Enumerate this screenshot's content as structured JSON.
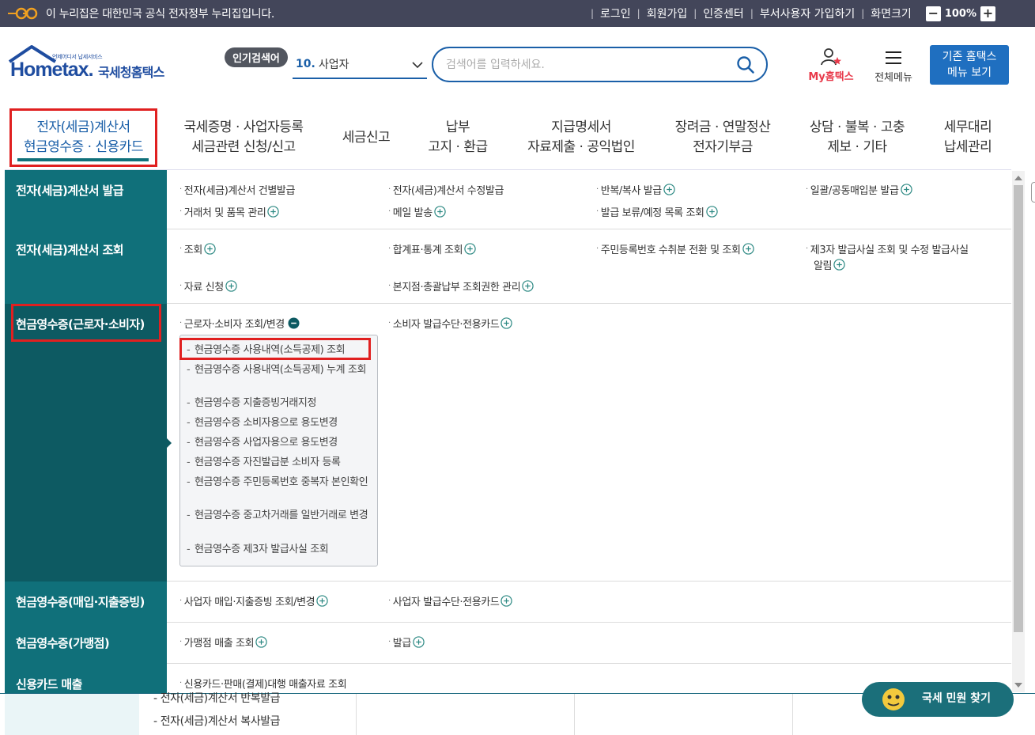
{
  "govbar": {
    "notice": "이 누리집은 대한민국 공식 전자정부 누리집입니다.",
    "links": [
      "로그인",
      "회원가입",
      "인증센터",
      "부서사용자 가입하기",
      "화면크기"
    ],
    "zoom": "100%"
  },
  "header": {
    "logo_text": "Hometax.",
    "logo_kr": "국세청홈택스",
    "logo_mini": "언제어디서 납세서비스",
    "popular_label": "인기검색어",
    "popular_num": "10.",
    "popular_value": "사업자",
    "search_placeholder": "검색어를 입력하세요.",
    "myhome": "My홈택스",
    "allmenu": "전체메뉴",
    "oldmenu_line1": "기존 홈택스",
    "oldmenu_line2": "메뉴 보기"
  },
  "gnb": [
    {
      "line1": "전자(세금)계산서",
      "line2": "현금영수증 · 신용카드"
    },
    {
      "line1": "국세증명 · 사업자등록",
      "line2": "세금관련 신청/신고"
    },
    {
      "line1": "세금신고",
      "line2": ""
    },
    {
      "line1": "납부",
      "line2": "고지 · 환급"
    },
    {
      "line1": "지급명세서",
      "line2": "자료제출 · 공익법인"
    },
    {
      "line1": "장려금 · 연말정산",
      "line2": "전자기부금"
    },
    {
      "line1": "상담 · 불복 · 고충",
      "line2": "제보 · 기타"
    },
    {
      "line1": "세무대리",
      "line2": "납세관리"
    }
  ],
  "panel": {
    "cat1": "전자(세금)계산서 발급",
    "cat1_links": [
      "전자(세금)계산서 건별발급",
      "전자(세금)계산서 수정발급",
      "반복/복사 발급",
      "일괄/공동매입분 발급",
      "거래처 및 품목 관리",
      "메일 발송",
      "발급 보류/예정 목록 조회"
    ],
    "cat2": "전자(세금)계산서 조회",
    "cat2_links": [
      "조회",
      "합계표·통계 조회",
      "주민등록번호 수취분 전환 및 조회",
      "제3자 발급사실 조회 및 수정 발급사실",
      "알림",
      "자료 신청",
      "본지점·총괄납부 조회권한 관리"
    ],
    "cat3": "현금영수증(근로자·소비자)",
    "cat3_links": [
      "근로자·소비자 조회/변경",
      "소비자 발급수단·전용카드"
    ],
    "cat3_sub": [
      "현금영수증 사용내역(소득공제) 조회",
      "현금영수증 사용내역(소득공제) 누계 조회",
      "현금영수증 지출증빙거래지정",
      "현금영수증 소비자용으로 용도변경",
      "현금영수증 사업자용으로 용도변경",
      "현금영수증 자진발급분 소비자 등록",
      "현금영수증 주민등록번호 중복자 본인확인",
      "현금영수증 중고차거래를 일반거래로 변경",
      "현금영수증 제3자 발급사실 조회"
    ],
    "cat4": "현금영수증(매입·지출증빙)",
    "cat4_links": [
      "사업자 매입·지출증빙 조회/변경",
      "사업자 발급수단·전용카드"
    ],
    "cat5": "현금영수증(가맹점)",
    "cat5_links": [
      "가맹점 매출 조회",
      "발급"
    ],
    "cat6": "신용카드 매출",
    "cat6_links": [
      "신용카드·판매(결제)대행 매출자료 조회"
    ]
  },
  "bottom": {
    "items": [
      "전자(세금)계산서 반복발급",
      "전자(세금)계산서 복사발급"
    ],
    "minwon": "국세 민원 찾기"
  }
}
